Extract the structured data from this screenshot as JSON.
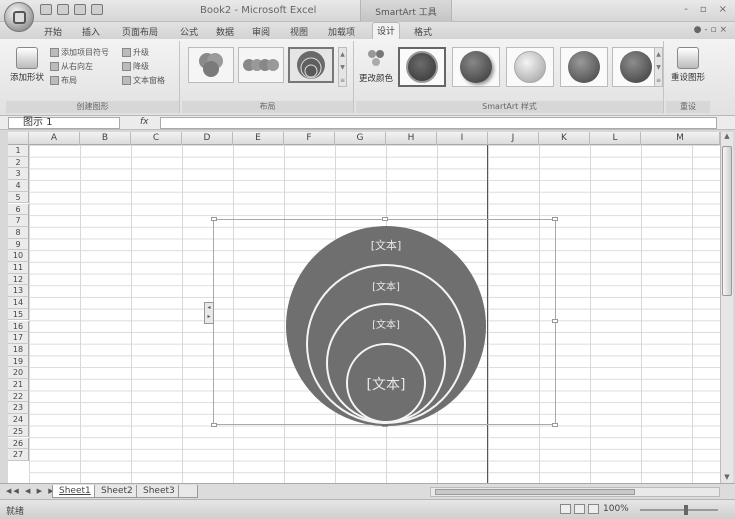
{
  "window": {
    "title": "Book2 - Microsoft Excel",
    "context_title": "SmartArt 工具",
    "controls": [
      "-",
      "▫",
      "×"
    ]
  },
  "tabs": [
    {
      "label": "开始"
    },
    {
      "label": "插入"
    },
    {
      "label": "页面布局"
    },
    {
      "label": "公式"
    },
    {
      "label": "数据"
    },
    {
      "label": "审阅"
    },
    {
      "label": "视图"
    },
    {
      "label": "加载项"
    },
    {
      "label": "设计"
    },
    {
      "label": "格式"
    }
  ],
  "help_controls": "● - ▫ ×",
  "ribbon": {
    "create_graphic": {
      "label": "创建图形",
      "add_shape": "添加形状",
      "add_bullet": "添加项目符号",
      "right_to_left": "从右向左",
      "layout": "布局",
      "promote": "升级",
      "demote": "降级",
      "text_pane": "文本窗格"
    },
    "layouts": {
      "label": "布局"
    },
    "styles": {
      "label": "SmartArt 样式",
      "change_colors": "更改颜色"
    },
    "reset": {
      "label": "重设",
      "reset_graphic": "重设图形"
    }
  },
  "formula_bar": {
    "name_box": "图示 1",
    "fx": "fx",
    "value": ""
  },
  "columns": [
    "A",
    "B",
    "C",
    "D",
    "E",
    "F",
    "G",
    "H",
    "I",
    "J",
    "K",
    "L",
    "M"
  ],
  "rows": [
    "1",
    "2",
    "3",
    "4",
    "5",
    "6",
    "7",
    "8",
    "9",
    "10",
    "11",
    "12",
    "13",
    "14",
    "15",
    "16",
    "17",
    "18",
    "19",
    "20",
    "21",
    "22",
    "23",
    "24",
    "25",
    "26",
    "27"
  ],
  "smartart": {
    "circles": [
      {
        "label": "[文本]"
      },
      {
        "label": "[文本]"
      },
      {
        "label": "[文本]"
      },
      {
        "label": "[文本]"
      }
    ],
    "fill_color": "#6f6f6f",
    "border_color": "#f4f4f4"
  },
  "sheet_tabs": [
    {
      "label": "Sheet1",
      "active": true
    },
    {
      "label": "Sheet2",
      "active": false
    },
    {
      "label": "Sheet3",
      "active": false
    }
  ],
  "status": {
    "left": "就绪",
    "zoom": "100%"
  }
}
